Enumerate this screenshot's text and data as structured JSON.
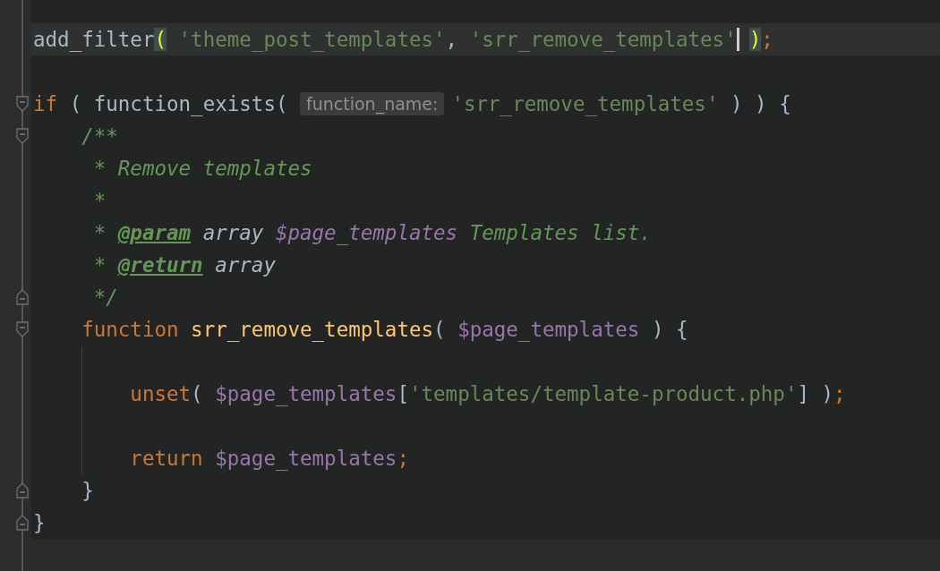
{
  "editor": {
    "lines": [
      {
        "kind": "code",
        "current": true,
        "tokens": [
          {
            "kind": "plain",
            "text": "add_filter"
          },
          {
            "kind": "brace_match",
            "text": "("
          },
          {
            "kind": "string",
            "text": " 'theme_post_templates'"
          },
          {
            "kind": "plain",
            "text": ", "
          },
          {
            "kind": "string",
            "text": "'srr_remove_templates'"
          },
          {
            "kind": "cursor"
          },
          {
            "kind": "brace_match",
            "text": ")"
          },
          {
            "kind": "keyword",
            "text": ";"
          }
        ]
      },
      {
        "kind": "blank"
      },
      {
        "kind": "code",
        "fold_start": true,
        "tokens": [
          {
            "kind": "keyword",
            "text": "if"
          },
          {
            "kind": "plain",
            "text": " ( function_exists( "
          },
          {
            "kind": "hint",
            "text": "function_name:"
          },
          {
            "kind": "string",
            "text": "'srr_remove_templates'"
          },
          {
            "kind": "plain",
            "text": " ) ) {"
          }
        ]
      },
      {
        "kind": "code",
        "fold_start": true,
        "tokens": [
          {
            "kind": "comment",
            "text": "    /**"
          }
        ]
      },
      {
        "kind": "code",
        "tokens": [
          {
            "kind": "comment",
            "text": "     * Remove templates"
          }
        ]
      },
      {
        "kind": "code",
        "tokens": [
          {
            "kind": "comment",
            "text": "     *"
          }
        ]
      },
      {
        "kind": "code",
        "tokens": [
          {
            "kind": "comment",
            "text": "     * "
          },
          {
            "kind": "doctag",
            "text": "@param"
          },
          {
            "kind": "doctype",
            "text": " array "
          },
          {
            "kind": "docvar",
            "text": "$page_templates"
          },
          {
            "kind": "comment",
            "text": " Templates list."
          }
        ]
      },
      {
        "kind": "code",
        "tokens": [
          {
            "kind": "comment",
            "text": "     * "
          },
          {
            "kind": "doctag",
            "text": "@return"
          },
          {
            "kind": "doctype",
            "text": " array"
          }
        ]
      },
      {
        "kind": "code",
        "fold_end": true,
        "tokens": [
          {
            "kind": "comment",
            "text": "     */"
          }
        ]
      },
      {
        "kind": "code",
        "fold_start": true,
        "tokens": [
          {
            "kind": "keyword",
            "text": "    function "
          },
          {
            "kind": "func",
            "text": "srr_remove_templates"
          },
          {
            "kind": "plain",
            "text": "( "
          },
          {
            "kind": "var",
            "text": "$page_templates"
          },
          {
            "kind": "plain",
            "text": " ) {"
          }
        ]
      },
      {
        "kind": "blank",
        "indent_guide": true
      },
      {
        "kind": "code",
        "indent_guide": true,
        "tokens": [
          {
            "kind": "keyword",
            "text": "        unset"
          },
          {
            "kind": "plain",
            "text": "( "
          },
          {
            "kind": "var",
            "text": "$page_templates"
          },
          {
            "kind": "plain",
            "text": "["
          },
          {
            "kind": "string",
            "text": "'templates/template-product.php'"
          },
          {
            "kind": "plain",
            "text": "] )"
          },
          {
            "kind": "keyword",
            "text": ";"
          }
        ]
      },
      {
        "kind": "blank",
        "indent_guide": true
      },
      {
        "kind": "code",
        "indent_guide": true,
        "tokens": [
          {
            "kind": "keyword",
            "text": "        return "
          },
          {
            "kind": "var",
            "text": "$page_templates"
          },
          {
            "kind": "keyword",
            "text": ";"
          }
        ]
      },
      {
        "kind": "code",
        "fold_end": true,
        "tokens": [
          {
            "kind": "plain",
            "text": "    }"
          }
        ]
      },
      {
        "kind": "code",
        "fold_end": true,
        "tokens": [
          {
            "kind": "plain",
            "text": "}"
          }
        ]
      }
    ]
  }
}
